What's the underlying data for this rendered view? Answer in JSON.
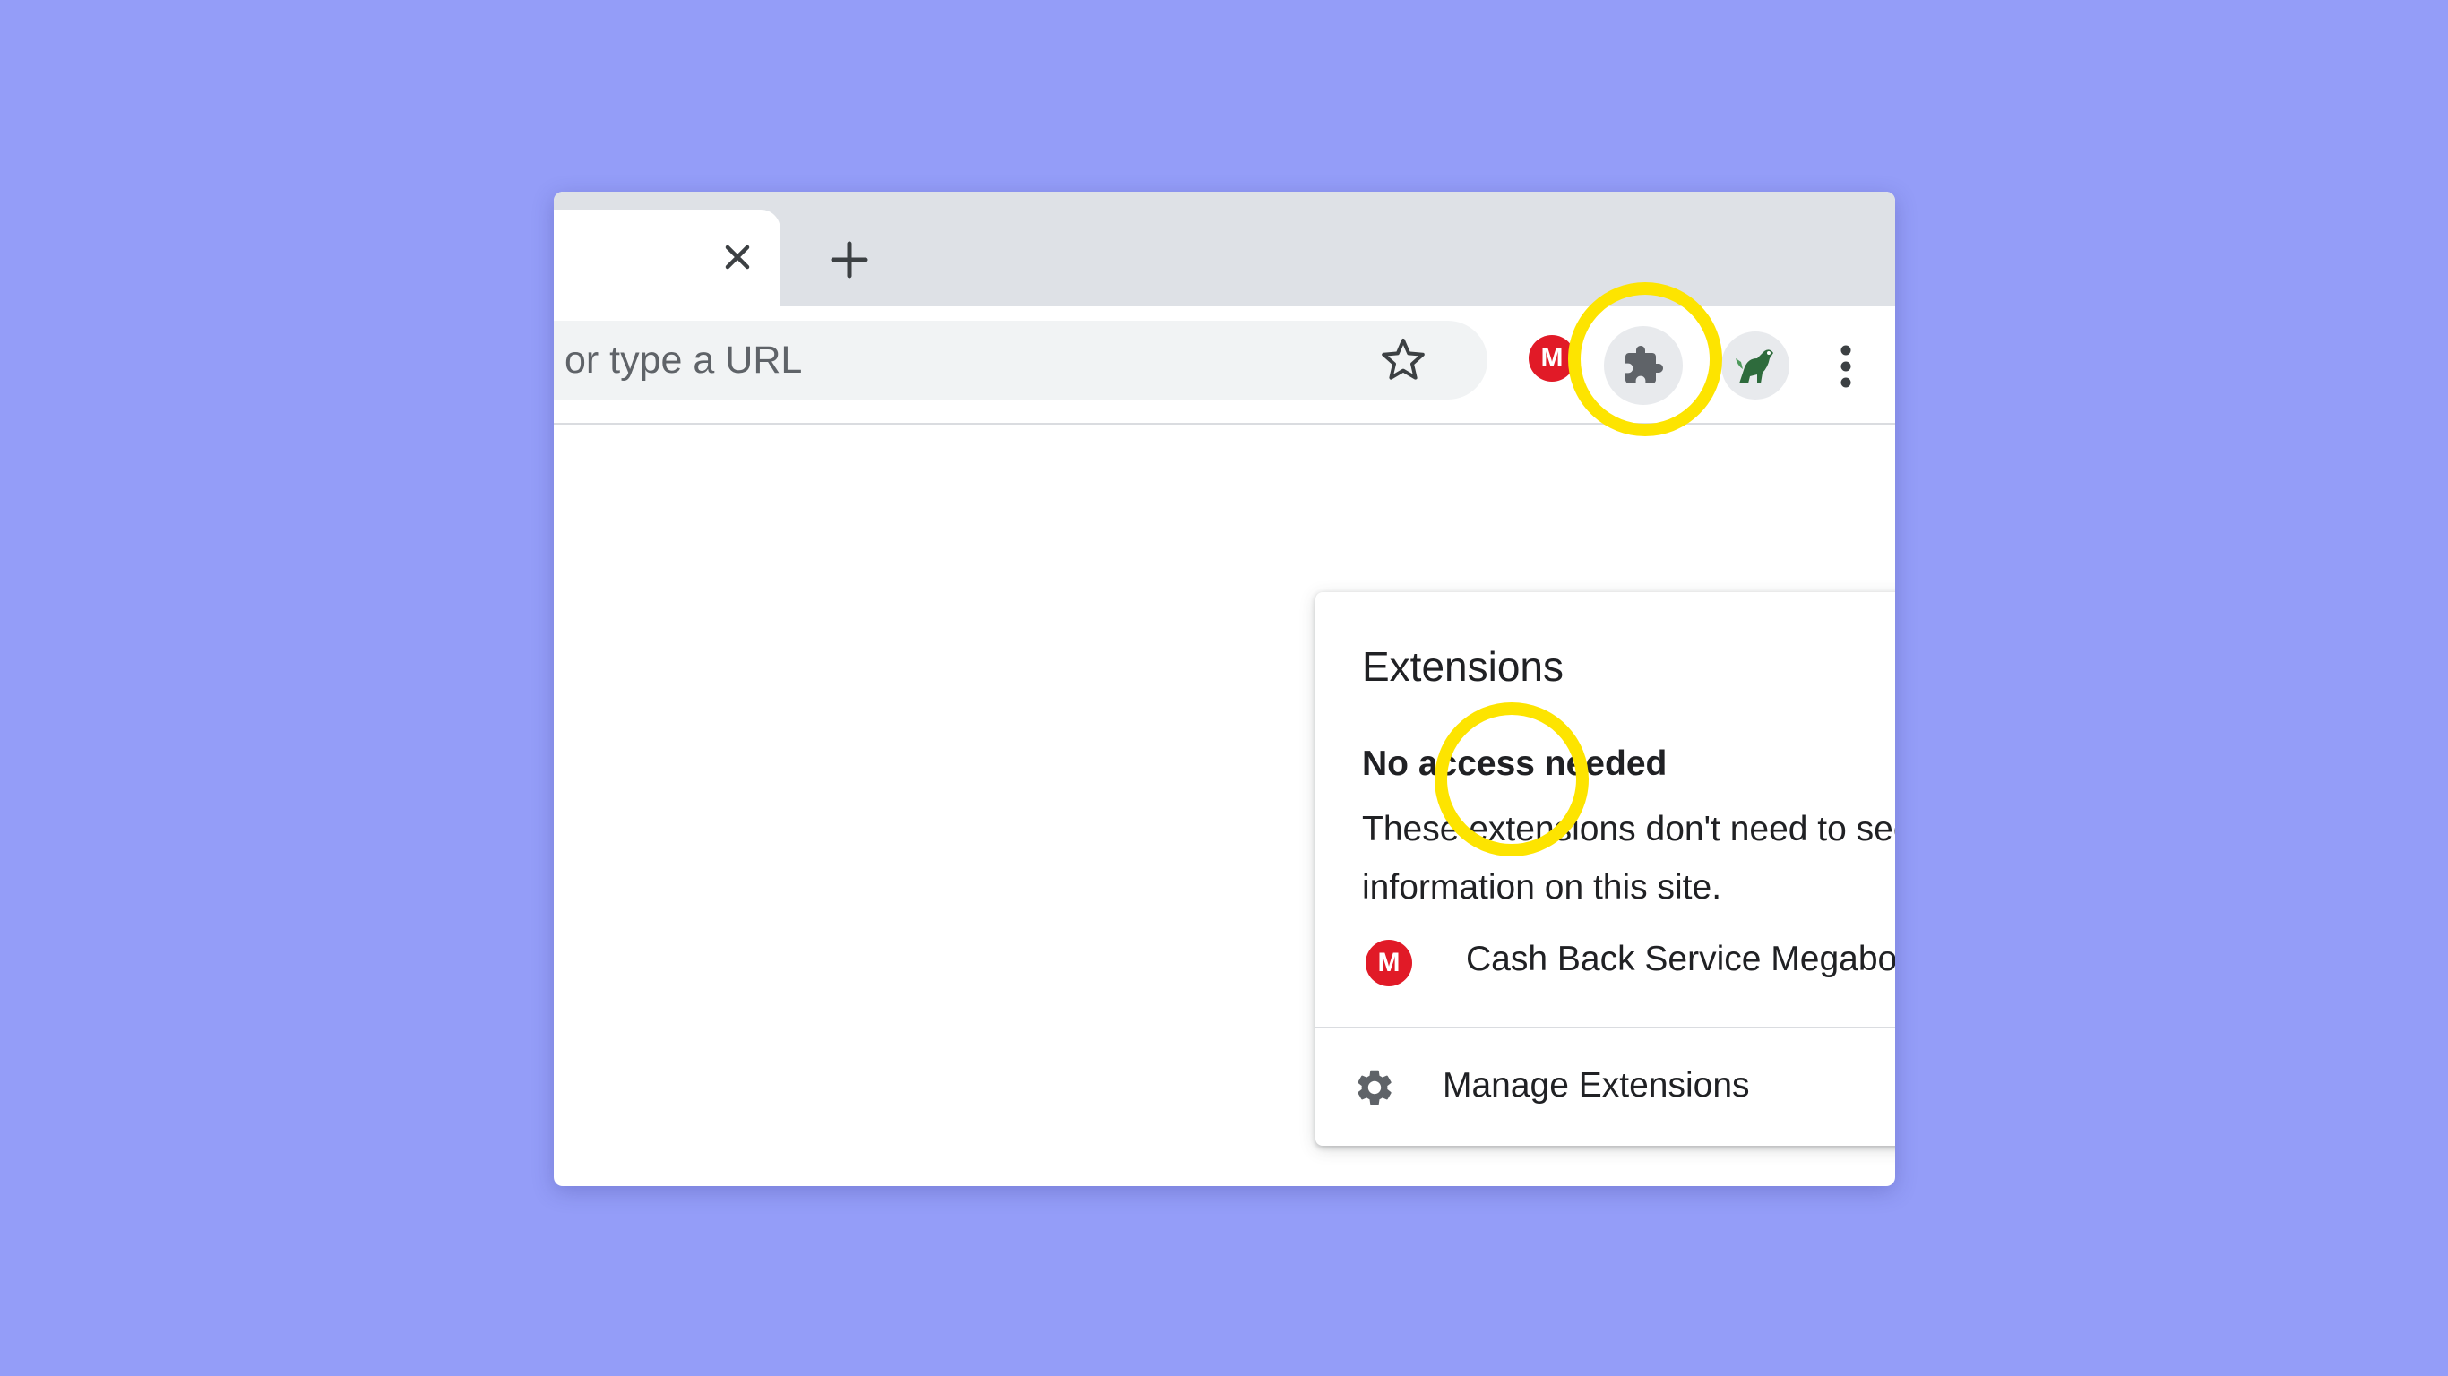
{
  "tabstrip": {
    "close_icon": "close-icon",
    "new_tab_icon": "plus-icon"
  },
  "toolbar": {
    "omnibox_text": "or type a URL",
    "star_icon": "star-outline-icon",
    "extension_badge_letter": "M",
    "extensions_icon": "puzzle-icon",
    "menu_icon": "kebab-icon"
  },
  "extensions_popup": {
    "title": "Extensions",
    "section_heading": "No access needed",
    "section_description": "These extensions don't need to see and change information on this site.",
    "extensions": [
      {
        "badge_letter": "M",
        "name": "Cash Back Service Megabonus",
        "pinned": true
      }
    ],
    "manage_label": "Manage Extensions"
  },
  "colors": {
    "background": "#949df8",
    "highlight": "#fde400",
    "extension_badge": "#e11a27",
    "pin_active": "#4285f4"
  }
}
